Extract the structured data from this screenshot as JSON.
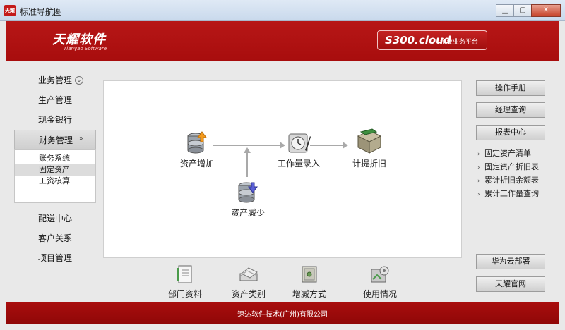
{
  "window": {
    "title": "标准导航图",
    "app_icon_text": "天耀",
    "minimize": "▁",
    "maximize": "▢",
    "close": "✕"
  },
  "header": {
    "brand": "天耀软件",
    "brand_en": "Tianyao Software",
    "platform_name": "S300.cloud",
    "platform_desc": "企业业务平台"
  },
  "left_nav": {
    "top_items": [
      {
        "label": "业务管理"
      },
      {
        "label": "生产管理"
      },
      {
        "label": "现金银行"
      },
      {
        "label": "财务管理"
      }
    ],
    "sub_items": [
      {
        "label": "账务系统"
      },
      {
        "label": "固定资产"
      },
      {
        "label": "工资核算"
      }
    ],
    "bottom_items": [
      {
        "label": "配送中心"
      },
      {
        "label": "客户关系"
      },
      {
        "label": "项目管理"
      }
    ]
  },
  "flow": {
    "asset_add": "资产增加",
    "workload": "工作量录入",
    "depreciation": "计提折旧",
    "asset_reduce": "资产减少"
  },
  "bottom_bar": [
    {
      "label": "部门资料"
    },
    {
      "label": "资产类别"
    },
    {
      "label": "增减方式"
    },
    {
      "label": "使用情况"
    }
  ],
  "right": {
    "manual": "操作手册",
    "manager_query": "经理查询",
    "report_center": "报表中心",
    "reports": [
      {
        "label": "固定资产清单"
      },
      {
        "label": "固定资产折旧表"
      },
      {
        "label": "累计折旧余额表"
      },
      {
        "label": "累计工作量查询"
      }
    ],
    "huawei": "华为云部署",
    "official": "天耀官网"
  },
  "footer": {
    "text": "速达软件技术(广州)有限公司"
  },
  "colors": {
    "header_red": "#b01212",
    "footer_red": "#9c0a0a"
  }
}
